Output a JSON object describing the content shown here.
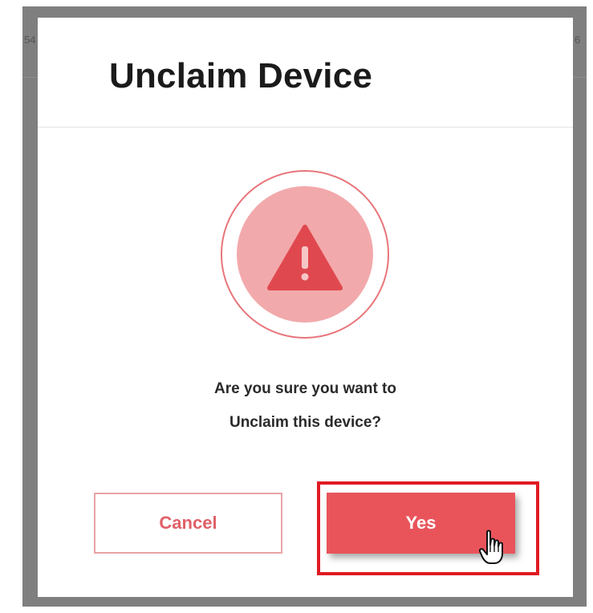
{
  "modal": {
    "title": "Unclaim Device",
    "message_line1": "Are you sure you want to",
    "message_line2": "Unclaim this device?",
    "icon": "warning-triangle-icon"
  },
  "buttons": {
    "cancel_label": "Cancel",
    "yes_label": "Yes"
  },
  "background": {
    "left_edge_text": "54",
    "right_edge_text": "6"
  },
  "colors": {
    "accent": "#e9545b",
    "warning_disc": "#f2a9ab",
    "highlight": "#e01b24"
  }
}
